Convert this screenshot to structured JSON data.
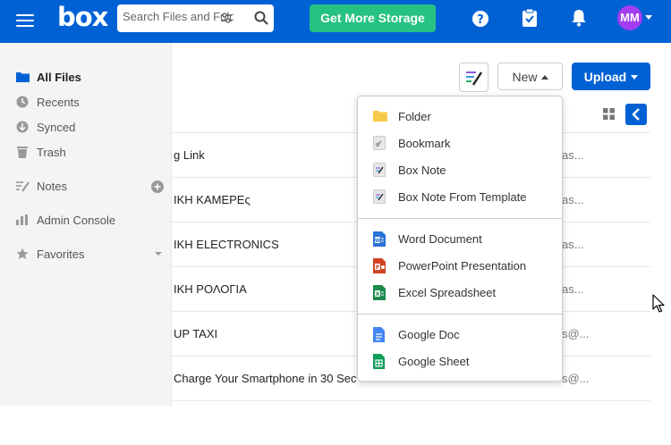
{
  "topbar": {
    "logo": "box",
    "search_placeholder": "Search Files and Folders",
    "storage_button": "Get More Storage",
    "avatar_initials": "MM",
    "brand_color": "#0061d5",
    "storage_color": "#26c281",
    "avatar_color": "#a23ef0"
  },
  "sidebar": {
    "items": [
      {
        "label": "All Files",
        "icon": "folder-icon"
      },
      {
        "label": "Recents",
        "icon": "clock-icon"
      },
      {
        "label": "Synced",
        "icon": "sync-icon"
      },
      {
        "label": "Trash",
        "icon": "trash-icon"
      },
      {
        "label": "Notes",
        "icon": "notes-icon"
      },
      {
        "label": "Admin Console",
        "icon": "bar-chart-icon"
      },
      {
        "label": "Favorites",
        "icon": "star-icon"
      }
    ]
  },
  "toolbar": {
    "new_label": "New",
    "upload_label": "Upload"
  },
  "files": [
    {
      "name": "g Link",
      "right": "as..."
    },
    {
      "name": "ΙΚΗ ΚΑΜΕΡΕς",
      "right": "as..."
    },
    {
      "name": "ΙΚΗ ELECTRONICS",
      "right": "as..."
    },
    {
      "name": "ΙΚΗ ΡΟΛΟΓΙΑ",
      "right": "as..."
    },
    {
      "name": "UP TAXI",
      "right": "s@..."
    },
    {
      "name": "Charge Your Smartphone in 30 Sec",
      "right": "s@..."
    }
  ],
  "new_menu": {
    "groups": [
      [
        {
          "label": "Folder",
          "icon": "folder-icon"
        },
        {
          "label": "Bookmark",
          "icon": "bookmark-icon"
        },
        {
          "label": "Box Note",
          "icon": "box-note-icon"
        },
        {
          "label": "Box Note From Template",
          "icon": "box-note-template-icon"
        }
      ],
      [
        {
          "label": "Word Document",
          "icon": "word-icon"
        },
        {
          "label": "PowerPoint Presentation",
          "icon": "powerpoint-icon"
        },
        {
          "label": "Excel Spreadsheet",
          "icon": "excel-icon"
        }
      ],
      [
        {
          "label": "Google Doc",
          "icon": "google-doc-icon"
        },
        {
          "label": "Google Sheet",
          "icon": "google-sheet-icon"
        }
      ]
    ]
  }
}
